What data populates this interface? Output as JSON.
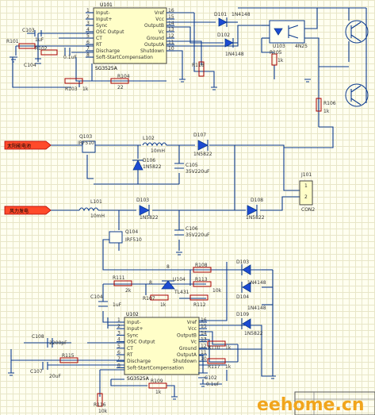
{
  "ic_top": {
    "ref": "U101",
    "part": "SG3525A",
    "pins_left": [
      {
        "n": "1",
        "name": "Input-"
      },
      {
        "n": "2",
        "name": "Input+"
      },
      {
        "n": "3",
        "name": "Sync"
      },
      {
        "n": "4",
        "name": "OSC Output"
      },
      {
        "n": "5",
        "name": "CT"
      },
      {
        "n": "6",
        "name": "RT"
      },
      {
        "n": "7",
        "name": "Discharge"
      },
      {
        "n": "8",
        "name": "Soft-StartCompensation"
      }
    ],
    "pins_right": [
      {
        "n": "16",
        "name": "Vref"
      },
      {
        "n": "15",
        "name": "Vcc"
      },
      {
        "n": "14",
        "name": "OutputB"
      },
      {
        "n": "13",
        "name": "Vc"
      },
      {
        "n": "12",
        "name": "Ground"
      },
      {
        "n": "11",
        "name": "OutputA"
      },
      {
        "n": "10",
        "name": "Shutdown"
      }
    ]
  },
  "ic_bottom": {
    "ref": "U102",
    "part": "SG3525A",
    "pins_left": [
      {
        "n": "1",
        "name": "Input-"
      },
      {
        "n": "2",
        "name": "Input+"
      },
      {
        "n": "3",
        "name": "Sync"
      },
      {
        "n": "4",
        "name": "OSC Output"
      },
      {
        "n": "5",
        "name": "CT"
      },
      {
        "n": "6",
        "name": "RT"
      },
      {
        "n": "7",
        "name": "Discharge"
      },
      {
        "n": "8",
        "name": "Soft-StartCompensation"
      }
    ],
    "pins_right": [
      {
        "n": "16",
        "name": "Vref"
      },
      {
        "n": "15",
        "name": "Vcc"
      },
      {
        "n": "14",
        "name": "OutputB"
      },
      {
        "n": "13",
        "name": "Vc"
      },
      {
        "n": "12",
        "name": "Ground"
      },
      {
        "n": "11",
        "name": "OutputA"
      },
      {
        "n": "10",
        "name": "Shutdown"
      }
    ]
  },
  "labels": {
    "c103": "C103",
    "c103v": "1uF",
    "r101": "R101",
    "r102": "R102",
    "c102v": "0.1uF",
    "c104": "C104",
    "r103": "R103",
    "r103v": "1k",
    "r104": "R104",
    "r104v": "22",
    "d101": "D101",
    "d101v": "1N4148",
    "d102": "D102",
    "d102v": "1N4148",
    "r118": "R118",
    "u103": "U103",
    "u103v": "4N25",
    "r105": "R105",
    "r105v": "1k",
    "r106": "R106",
    "r106v": "1k",
    "q103": "Q103",
    "q103v": "IRF510",
    "l102": "L102",
    "l102v": "10mH",
    "d107": "D107",
    "d107v": "1N5822",
    "d106": "D106",
    "d106v": "1N5822",
    "c105": "C105",
    "c105v": "35V220uF",
    "j101": "J101",
    "j101v": "CON2",
    "l101": "L101",
    "l101v": "10mH",
    "d103": "D103",
    "d103v": "1N5822",
    "d108": "D108",
    "d108v": "1N5822",
    "c106": "C106",
    "c106v": "35V220uF",
    "q104": "Q104",
    "q104v": "IRF510",
    "r111": "R111",
    "r111v": "2k",
    "c104b": "C104",
    "c104bv": "1uF",
    "r107": "R107",
    "r107v": "1k",
    "u104": "U104",
    "r112": "R112",
    "r108": "R108",
    "r113": "R113",
    "r113v": "10k",
    "d103b": "D103",
    "d103bv": "1N4148",
    "d104": "D104",
    "d104v": "1N4148",
    "d109": "D109",
    "d109v": "1N5822",
    "c108": "C108",
    "c108v": "2200pF",
    "c107": "C107",
    "c107v": "20uF",
    "r115": "R115",
    "r110": "R110",
    "r110v": "1k",
    "r117": "R117",
    "r117v": "1k",
    "r109": "R109",
    "r109v": "1k",
    "c102b": "C102",
    "c102bv": "0.1uF",
    "r116": "R116",
    "r116v": "10k",
    "pin_n8": "8",
    "pin_n8b": "8",
    "tl431": "TL431",
    "j101p1": "1",
    "j101p2": "2"
  },
  "ports": {
    "port1": "太阳能电池",
    "port2": "风力发电"
  },
  "watermark": "eehome.cn"
}
